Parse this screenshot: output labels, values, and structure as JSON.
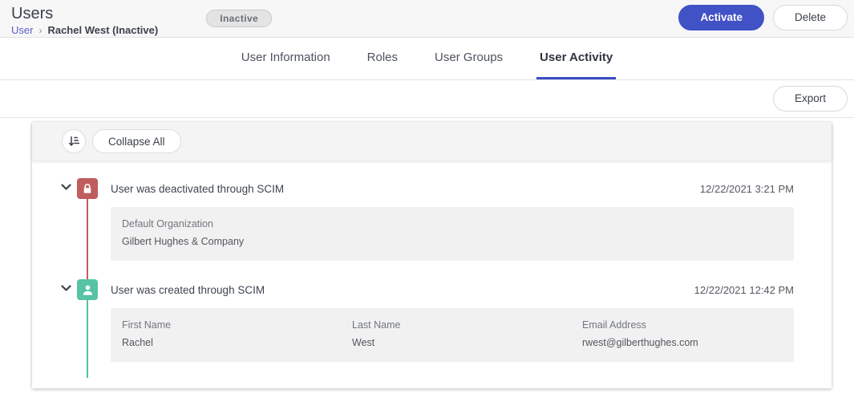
{
  "header": {
    "title": "Users",
    "breadcrumb": {
      "parent": "User",
      "separator": "›",
      "current": "Rachel West (Inactive)"
    },
    "status_badge": "Inactive",
    "activate_button": "Activate",
    "delete_button": "Delete"
  },
  "tabs": {
    "items": [
      {
        "label": "User Information",
        "active": false
      },
      {
        "label": "Roles",
        "active": false
      },
      {
        "label": "User Groups",
        "active": false
      },
      {
        "label": "User Activity",
        "active": true
      }
    ]
  },
  "toolbar": {
    "export_button": "Export",
    "sort_icon": "sort-amount-icon",
    "collapse_all_button": "Collapse All"
  },
  "activity": {
    "entries": [
      {
        "icon": "lock-icon",
        "icon_color": "#c05d5d",
        "title": "User was deactivated through SCIM",
        "timestamp": "12/22/2021 3:21 PM",
        "fields": [
          {
            "label": "Default Organization",
            "value": "Gilbert Hughes & Company"
          }
        ]
      },
      {
        "icon": "user-icon",
        "icon_color": "#57c2a4",
        "title": "User was created through SCIM",
        "timestamp": "12/22/2021 12:42 PM",
        "fields": [
          {
            "label": "First Name",
            "value": "Rachel"
          },
          {
            "label": "Last Name",
            "value": "West"
          },
          {
            "label": "Email Address",
            "value": "rwest@gilberthughes.com"
          }
        ]
      }
    ]
  },
  "colors": {
    "accent": "#4151c6",
    "tab_underline": "#3b4cc4",
    "deactivated_event": "#c05d5d",
    "created_event": "#57c2a4"
  }
}
